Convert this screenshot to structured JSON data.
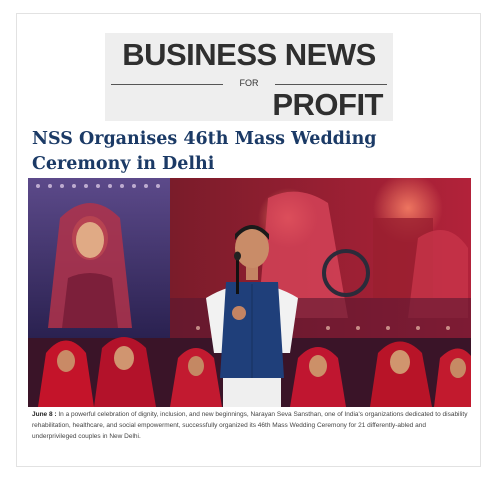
{
  "masthead": {
    "line1": "BUSINESS NEWS",
    "line2": "FOR",
    "line3": "PROFIT"
  },
  "article": {
    "headline": "NSS Organises 46th Mass Wedding Ceremony in Delhi",
    "date_label": "June 8 :",
    "body": " In a powerful celebration of dignity, inclusion, and new beginnings, Narayan Seva Sansthan, one of India's organizations dedicated to disability rehabilitation, healthcare, and social empowerment, successfully organized its 46th Mass Wedding Ceremony for 21 differently-abled and underprivileged couples in New Delhi."
  },
  "colors": {
    "headline": "#1b3a66",
    "masthead_bg": "#eeeeee",
    "stage_red": "#c4142a",
    "vest_blue": "#1f3f7a"
  }
}
